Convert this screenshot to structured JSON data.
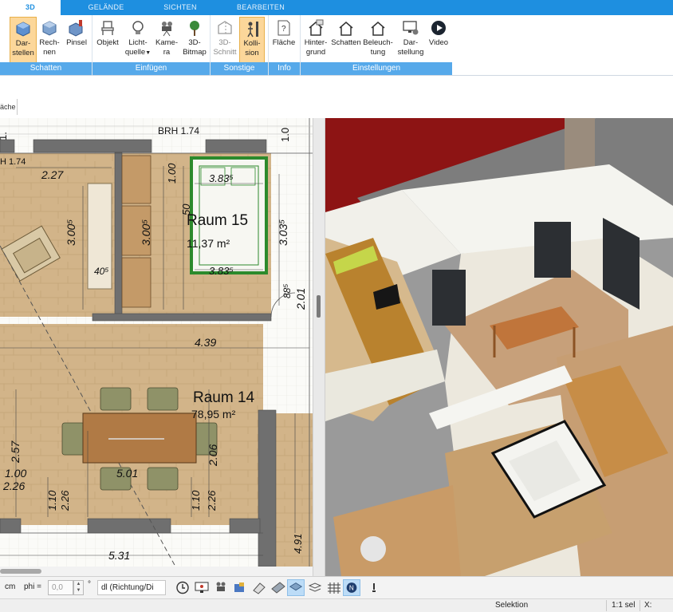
{
  "ribbon_tabs": {
    "t3d": "3D",
    "gelaende": "GELÄNDE",
    "sichten": "SICHTEN",
    "bearbeiten": "BEARBEITEN"
  },
  "ribbon": {
    "buttons": {
      "darstellen_1": "Dar-",
      "darstellen_2": "stellen",
      "rechnen_1": "Rech-",
      "rechnen_2": "nen",
      "pinsel": "Pinsel",
      "objekt": "Objekt",
      "lichtquelle_1": "Licht-",
      "lichtquelle_2": "quelle",
      "kamera_1": "Kame-",
      "kamera_2": "ra",
      "bitmap_1": "3D-",
      "bitmap_2": "Bitmap",
      "schnitt_1": "3D-",
      "schnitt_2": "Schnitt",
      "kollision_1": "Kolli-",
      "kollision_2": "sion",
      "flaeche": "Fläche",
      "hintergrund_1": "Hinter-",
      "hintergrund_2": "grund",
      "schatten": "Schatten",
      "beleuchtung_1": "Beleuch-",
      "beleuchtung_2": "tung",
      "darstellung_1": "Dar-",
      "darstellung_2": "stellung",
      "video": "Video"
    },
    "groups": {
      "schatten": "Schatten",
      "einfuegen": "Einfügen",
      "sonstige": "Sonstige",
      "info": "Info",
      "einstellungen": "Einstellungen"
    }
  },
  "doc_tab": "äche",
  "plan": {
    "brh_top": "BRH 1.74",
    "brh_left": "H 1.74",
    "room15_name": "Raum 15",
    "room15_area": "11,37 m²",
    "room14_name": "Raum 14",
    "room14_area": "78,95 m²",
    "dims": {
      "d227": "2.27",
      "d3005_left": "3.00⁵",
      "d405": "40⁵",
      "d100_top": "1.00",
      "d50": "50",
      "d3835_top": "3.83⁵",
      "d3005_mid": "3.00⁵",
      "d3035": "3.03⁵",
      "d3835_bot": "3.83⁵",
      "d885": "88⁵",
      "d201": "2.01",
      "d439": "4.39",
      "d257": "2.57",
      "d100_left": "1.00",
      "d226_left": "2.26",
      "d206": "2.06",
      "d501": "5.01",
      "d110_a": "1.10",
      "d226_a": "2.26",
      "d110_b": "1.10",
      "d226_b": "2.26",
      "d491": "4.91",
      "d531": "5.31",
      "d1_top": "1.",
      "d1_topright": "1.0"
    }
  },
  "bottombar": {
    "cm": "cm",
    "phi_label": "phi =",
    "phi_value": "0,0",
    "degree": "°",
    "combo": "dl (Richtung/Di"
  },
  "icons": {
    "clock": "clock-icon",
    "monitor": "monitor-icon",
    "camera": "camera-icon",
    "palette": "palette-icon",
    "eraser": "eraser-icon",
    "ruler": "ruler-icon",
    "layers": "layers-icon",
    "stack": "stack-icon",
    "grid": "grid-icon",
    "north": "north-icon",
    "pin": "pin-icon"
  },
  "statusbar": {
    "mode": "Selektion",
    "selection": "1:1 sel",
    "x_label": "X:"
  },
  "colors": {
    "ribbon_blue": "#1e8fe0",
    "group_blue": "#56a9ea",
    "selected_button": "#fcd79a",
    "floor_wood": "#c9a97a",
    "bed_green": "#2c8a2c"
  }
}
